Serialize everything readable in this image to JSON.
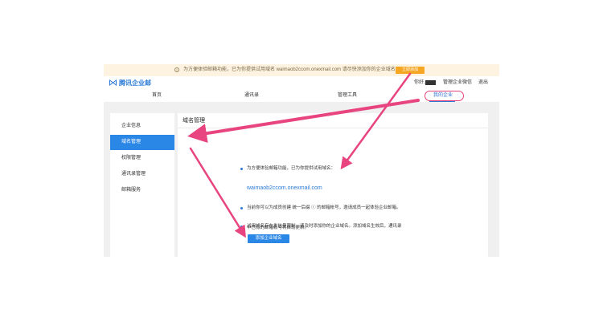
{
  "notice": {
    "text": "为方便体验邮箱功能，已为你提供试用域名 waimaob2ccom.onexmail.com 请尽快添加你的企业域名。",
    "button": "立即添加"
  },
  "topbar": {
    "logo_text": "腾讯企业邮",
    "greeting": "你好,",
    "links": [
      "管理企业微信",
      "退出"
    ]
  },
  "nav": {
    "items": [
      "首页",
      "通讯录",
      "管理工具",
      "我的企业"
    ],
    "active_index": 3
  },
  "sidebar": {
    "items": [
      "企业信息",
      "域名管理",
      "权限管理",
      "通讯录管理",
      "邮箱服务"
    ],
    "active_index": 1
  },
  "main": {
    "title": "域名管理",
    "tip1": "为方便体验邮箱功能，已为你提供试用域名：",
    "trial_domain": "waimaob2ccom.onexmail.com",
    "tip2": "当前你可以为成员创建 统一后缀 ⓘ 的邮箱帐号，邀请成员一起体验企业邮箱。",
    "tip3_line1": "试用域名存在发信量限制，请及时添加你的企业域名。添加域名生效后，通讯录",
    "tip3_line2": "中已有的邮箱帐号将自动更新。",
    "add_button": "添加企业域名"
  },
  "colors": {
    "accent": "#2b87e6",
    "notice_bg": "#fdf3e0",
    "notice_button": "#f5a623",
    "annotation": "#e8447f"
  }
}
